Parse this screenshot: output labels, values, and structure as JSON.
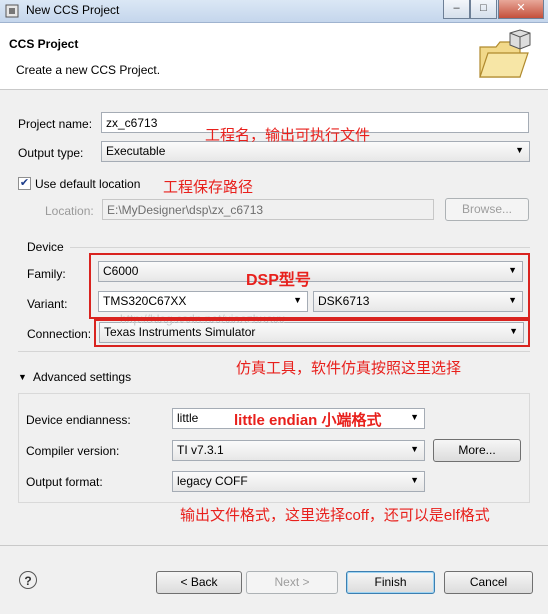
{
  "window": {
    "title": "New CCS Project",
    "minimize": "–",
    "maximize": "□",
    "close": "✕"
  },
  "header": {
    "title": "CCS Project",
    "subtitle": "Create a new CCS Project."
  },
  "form": {
    "project_name_label": "Project name:",
    "project_name_value": "zx_c6713",
    "output_type_label": "Output type:",
    "output_type_value": "Executable",
    "use_default_location_label": "Use default location",
    "use_default_location_checked": true,
    "location_label": "Location:",
    "location_value": "E:\\MyDesigner\\dsp\\zx_c6713",
    "browse_button": "Browse..."
  },
  "device": {
    "group_label": "Device",
    "family_label": "Family:",
    "family_value": "C6000",
    "variant_label": "Variant:",
    "variant_value": "TMS320C67XX",
    "variant_board_value": "DSK6713",
    "connection_label": "Connection:",
    "connection_value": "Texas Instruments Simulator"
  },
  "advanced": {
    "toggle_label": "Advanced settings",
    "endianness_label": "Device endianness:",
    "endianness_value": "little",
    "compiler_label": "Compiler version:",
    "compiler_value": "TI v7.3.1",
    "more_button": "More...",
    "output_format_label": "Output format:",
    "output_format_value": "legacy COFF"
  },
  "annotations": {
    "project_name": "工程名，输出可执行文件",
    "location": "工程保存路径",
    "dsp_model": "DSP型号",
    "simulator": "仿真工具，软件仿真按照这里选择",
    "endianness": "little endian 小端格式",
    "output_format": "输出文件格式，这里选择coff，还可以是elf格式",
    "color": "#e8201c"
  },
  "watermark": "http://blog.csdn.net/xiaozhuoxx",
  "footer": {
    "help": "?",
    "back_button": "< Back",
    "next_button": "Next >",
    "finish_button": "Finish",
    "cancel_button": "Cancel"
  }
}
